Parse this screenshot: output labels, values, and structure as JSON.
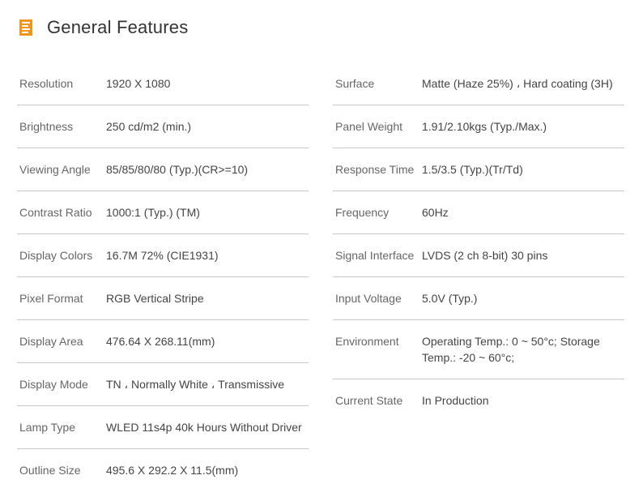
{
  "header": {
    "title": "General Features",
    "icon": "document-list-icon",
    "accent_color": "#f39518"
  },
  "left_specs": [
    {
      "label": "Resolution",
      "value": "1920 X 1080"
    },
    {
      "label": "Brightness",
      "value": "250 cd/m2 (min.)"
    },
    {
      "label": "Viewing Angle",
      "value": "85/85/80/80 (Typ.)(CR>=10)"
    },
    {
      "label": "Contrast Ratio",
      "value": "1000:1 (Typ.) (TM)"
    },
    {
      "label": "Display Colors",
      "value": "16.7M 72% (CIE1931)"
    },
    {
      "label": "Pixel Format",
      "value": "RGB Vertical Stripe"
    },
    {
      "label": "Display Area",
      "value": "476.64 X 268.11(mm)"
    },
    {
      "label": "Display Mode",
      "value": "TN ، Normally White ، Transmissive"
    },
    {
      "label": "Lamp Type",
      "value": "WLED 11s4p 40k Hours Without Driver"
    },
    {
      "label": "Outline Size",
      "value": "495.6 X 292.2 X 11.5(mm)"
    }
  ],
  "right_specs": [
    {
      "label": "Surface",
      "value": "Matte (Haze 25%) ، Hard coating (3H)"
    },
    {
      "label": "Panel Weight",
      "value": "1.91/2.10kgs (Typ./Max.)"
    },
    {
      "label": "Response Time",
      "value": "1.5/3.5 (Typ.)(Tr/Td)"
    },
    {
      "label": "Frequency",
      "value": "60Hz"
    },
    {
      "label": "Signal Interface",
      "value": "LVDS (2 ch 8-bit) 30 pins"
    },
    {
      "label": "Input Voltage",
      "value": "5.0V (Typ.)"
    },
    {
      "label": "Environment",
      "value": "Operating Temp.: 0 ~ 50°c; Storage Temp.: -20 ~ 60°c;"
    },
    {
      "label": "Current State",
      "value": "In Production"
    }
  ]
}
